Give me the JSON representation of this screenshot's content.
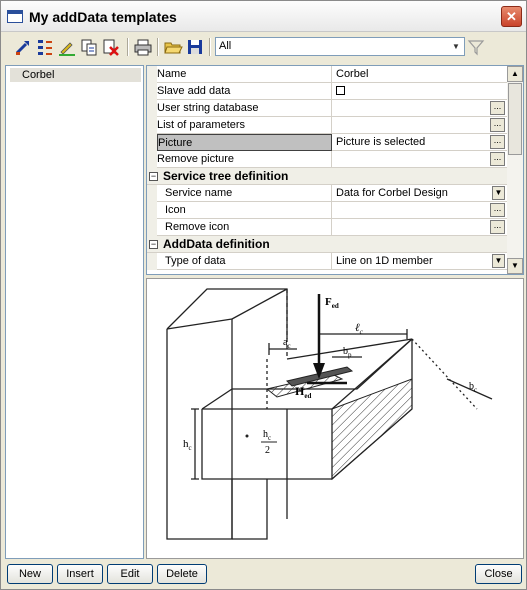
{
  "window": {
    "title": "My addData templates"
  },
  "toolbar": {
    "filter_value": "All",
    "icons": [
      "new-template-icon",
      "arrange-icon",
      "edit-icon",
      "copy-icon",
      "delete-icon",
      "print-icon",
      "open-folder-icon",
      "save-icon",
      "filter-icon"
    ]
  },
  "tree": {
    "items": [
      {
        "label": "Corbel"
      }
    ]
  },
  "properties": {
    "rows": [
      {
        "key": "Name",
        "value": "Corbel"
      },
      {
        "key": "Slave add data",
        "value": ""
      },
      {
        "key": "User string database",
        "value": ""
      },
      {
        "key": "List of parameters",
        "value": ""
      },
      {
        "key": "Picture",
        "value": "Picture is selected"
      },
      {
        "key": "Remove picture",
        "value": ""
      }
    ],
    "category_service": "Service tree definition",
    "service_rows": [
      {
        "key": "Service name",
        "value": "Data for Corbel Design"
      },
      {
        "key": "Icon",
        "value": ""
      },
      {
        "key": "Remove icon",
        "value": ""
      }
    ],
    "category_adddata": "AddData definition",
    "adddata_rows": [
      {
        "key": "Type of data",
        "value": "Line on 1D member"
      }
    ],
    "ellipsis": "..."
  },
  "picture": {
    "labels": {
      "force": "F",
      "force_sub": "ed",
      "a": "a",
      "a_sub": "c",
      "l": "ℓ",
      "l_sub": "c",
      "b": "b",
      "b_sub": "p",
      "h_force": "H",
      "h_force_sub": "ed",
      "b_c": "b",
      "b_c_sub": "c",
      "h_c": "h",
      "h_c_sub": "c",
      "half_num": "h",
      "half_num_sub": "c",
      "half_den": "2"
    }
  },
  "buttons": {
    "new": "New",
    "insert": "Insert",
    "edit": "Edit",
    "delete": "Delete",
    "close": "Close"
  },
  "colors": {
    "accent": "#003c74",
    "selection": "#c0c0c0"
  }
}
